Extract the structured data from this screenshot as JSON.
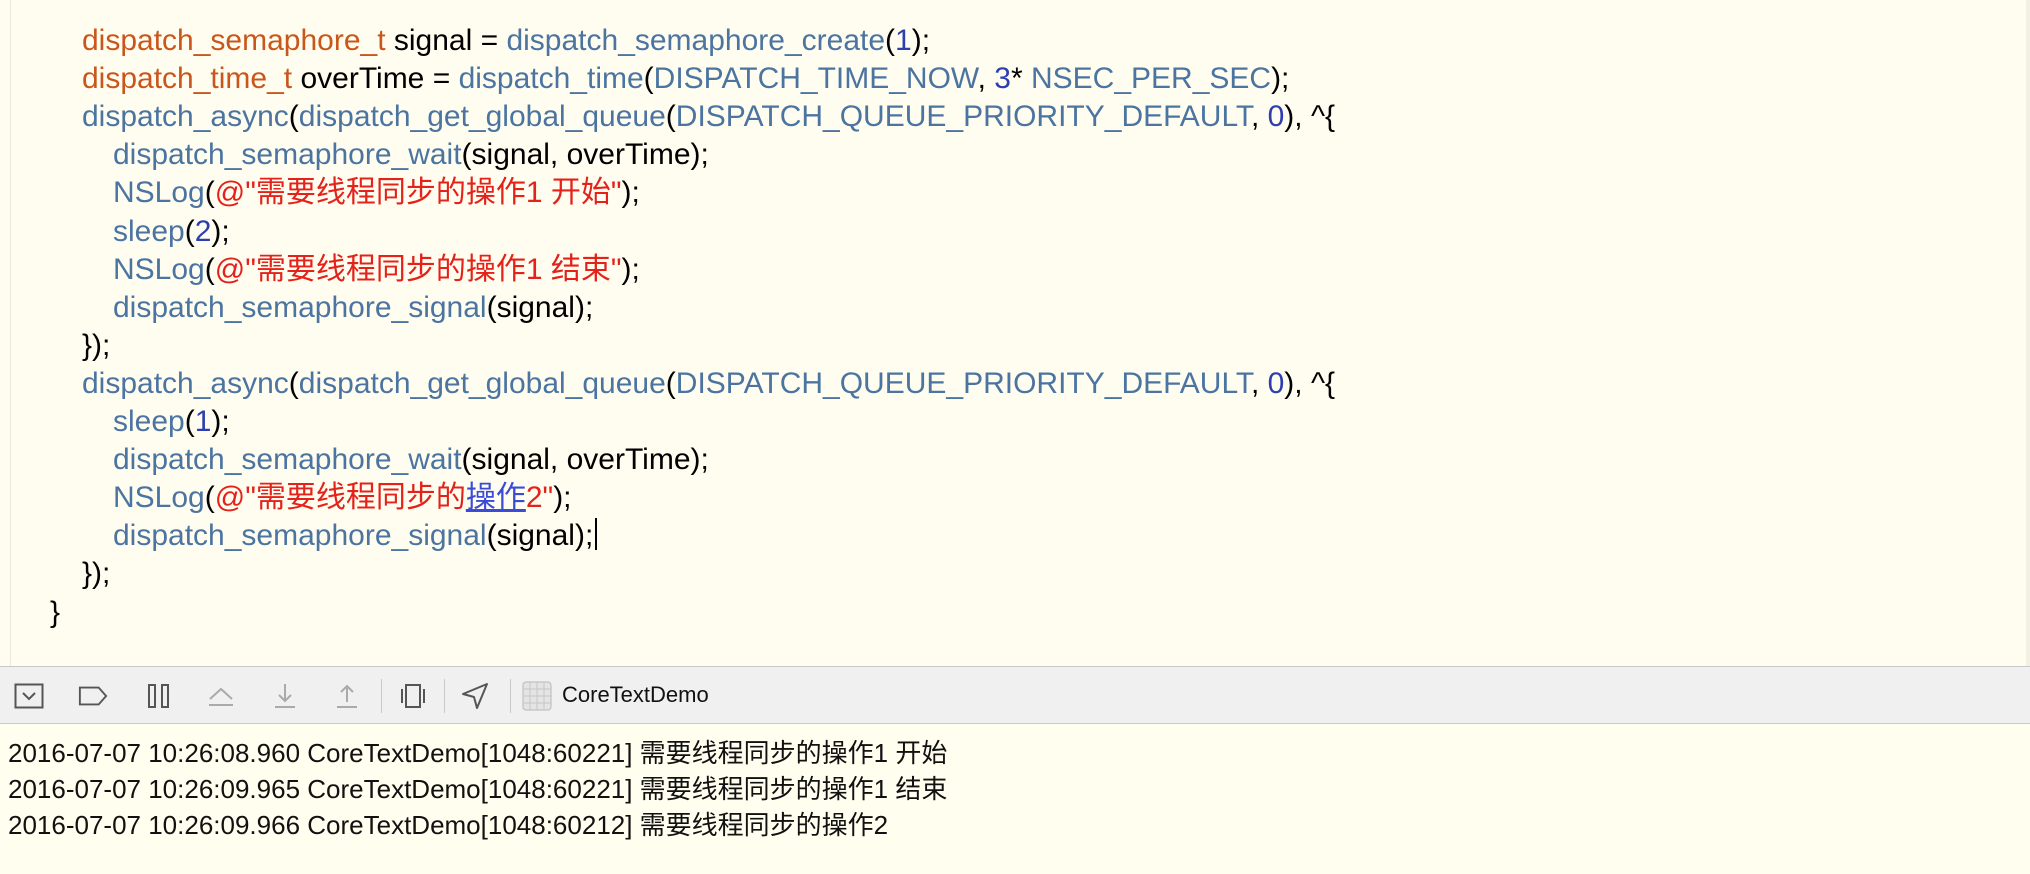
{
  "editor": {
    "lines": [
      [
        {
          "c": "kw",
          "t": "dispatch_semaphore_t"
        },
        {
          "c": "",
          "t": " signal = "
        },
        {
          "c": "fn",
          "t": "dispatch_semaphore_create"
        },
        {
          "c": "",
          "t": "("
        },
        {
          "c": "num",
          "t": "1"
        },
        {
          "c": "",
          "t": ");"
        }
      ],
      [
        {
          "c": "kw",
          "t": "dispatch_time_t"
        },
        {
          "c": "",
          "t": " overTime = "
        },
        {
          "c": "fn",
          "t": "dispatch_time"
        },
        {
          "c": "",
          "t": "("
        },
        {
          "c": "fn",
          "t": "DISPATCH_TIME_NOW"
        },
        {
          "c": "",
          "t": ", "
        },
        {
          "c": "num",
          "t": "3"
        },
        {
          "c": "",
          "t": "* "
        },
        {
          "c": "fn",
          "t": "NSEC_PER_SEC"
        },
        {
          "c": "",
          "t": ");"
        }
      ],
      [
        {
          "c": "fn",
          "t": "dispatch_async"
        },
        {
          "c": "",
          "t": "("
        },
        {
          "c": "fn",
          "t": "dispatch_get_global_queue"
        },
        {
          "c": "",
          "t": "("
        },
        {
          "c": "fn",
          "t": "DISPATCH_QUEUE_PRIORITY_DEFAULT"
        },
        {
          "c": "",
          "t": ", "
        },
        {
          "c": "num",
          "t": "0"
        },
        {
          "c": "",
          "t": "), ^{"
        }
      ],
      [
        {
          "c": "fn",
          "t": "dispatch_semaphore_wait"
        },
        {
          "c": "",
          "t": "(signal, overTime);"
        }
      ],
      [
        {
          "c": "fn",
          "t": "NSLog"
        },
        {
          "c": "",
          "t": "("
        },
        {
          "c": "str",
          "t": "@\"需要线程同步的操作1 开始\""
        },
        {
          "c": "",
          "t": ");"
        }
      ],
      [
        {
          "c": "fn",
          "t": "sleep"
        },
        {
          "c": "",
          "t": "("
        },
        {
          "c": "num",
          "t": "2"
        },
        {
          "c": "",
          "t": ");"
        }
      ],
      [
        {
          "c": "fn",
          "t": "NSLog"
        },
        {
          "c": "",
          "t": "("
        },
        {
          "c": "str",
          "t": "@\"需要线程同步的操作1 结束\""
        },
        {
          "c": "",
          "t": ");"
        }
      ],
      [
        {
          "c": "fn",
          "t": "dispatch_semaphore_signal"
        },
        {
          "c": "",
          "t": "(signal);"
        }
      ],
      [
        {
          "c": "",
          "t": "});"
        }
      ],
      [
        {
          "c": "fn",
          "t": "dispatch_async"
        },
        {
          "c": "",
          "t": "("
        },
        {
          "c": "fn",
          "t": "dispatch_get_global_queue"
        },
        {
          "c": "",
          "t": "("
        },
        {
          "c": "fn",
          "t": "DISPATCH_QUEUE_PRIORITY_DEFAULT"
        },
        {
          "c": "",
          "t": ", "
        },
        {
          "c": "num",
          "t": "0"
        },
        {
          "c": "",
          "t": "), ^{"
        }
      ],
      [
        {
          "c": "fn",
          "t": "sleep"
        },
        {
          "c": "",
          "t": "("
        },
        {
          "c": "num",
          "t": "1"
        },
        {
          "c": "",
          "t": ");"
        }
      ],
      [
        {
          "c": "fn",
          "t": "dispatch_semaphore_wait"
        },
        {
          "c": "",
          "t": "(signal, overTime);"
        }
      ],
      [
        {
          "c": "fn",
          "t": "NSLog"
        },
        {
          "c": "",
          "t": "("
        },
        {
          "c": "str",
          "t": "@\"需要线程同步的"
        },
        {
          "c": "str-link",
          "t": "操作"
        },
        {
          "c": "str",
          "t": "2\""
        },
        {
          "c": "",
          "t": ");"
        }
      ],
      [
        {
          "c": "fn",
          "t": "dispatch_semaphore_signal"
        },
        {
          "c": "",
          "t": "(signal);"
        }
      ],
      [
        {
          "c": "",
          "t": "});"
        }
      ],
      [
        {
          "c": "",
          "t": "}"
        }
      ]
    ]
  },
  "debug_bar": {
    "buttons": [
      {
        "name": "hide-debug-area-icon"
      },
      {
        "name": "breakpoints-toggle-icon"
      },
      {
        "name": "pause-icon"
      },
      {
        "name": "step-over-icon"
      },
      {
        "name": "step-into-icon"
      },
      {
        "name": "step-out-icon"
      },
      {
        "name": "view-hierarchy-icon"
      },
      {
        "name": "simulate-location-icon"
      }
    ],
    "target_label": "CoreTextDemo"
  },
  "console": {
    "lines": [
      "2016-07-07 10:26:08.960 CoreTextDemo[1048:60221] 需要线程同步的操作1 开始",
      "2016-07-07 10:26:09.965 CoreTextDemo[1048:60221] 需要线程同步的操作1 结束",
      "2016-07-07 10:26:09.966 CoreTextDemo[1048:60212] 需要线程同步的操作2"
    ]
  }
}
